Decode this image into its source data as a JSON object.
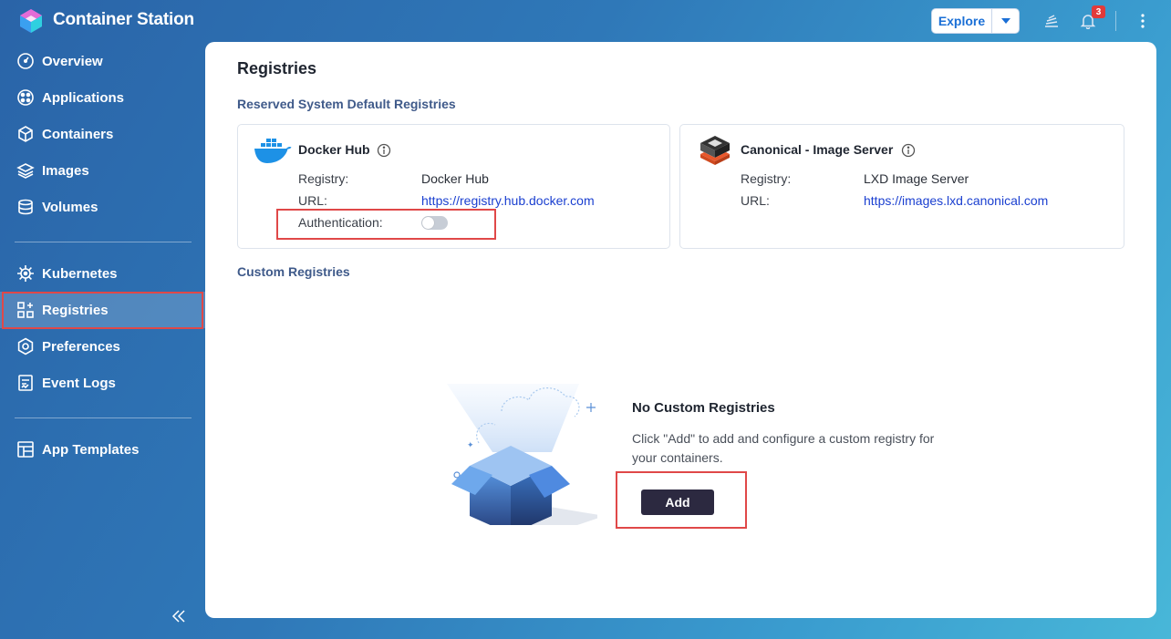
{
  "app": {
    "title": "Container Station",
    "logo_icon": "container-station-logo-icon"
  },
  "header": {
    "explore_label": "Explore",
    "notification_count": "3",
    "icons": [
      "explore-caret-icon",
      "tasks-stack-icon",
      "bell-icon",
      "more-vertical-icon"
    ]
  },
  "sidebar": {
    "items": [
      {
        "label": "Overview",
        "icon": "gauge-icon"
      },
      {
        "label": "Applications",
        "icon": "apps-icon"
      },
      {
        "label": "Containers",
        "icon": "cube-icon"
      },
      {
        "label": "Images",
        "icon": "layers-icon"
      },
      {
        "label": "Volumes",
        "icon": "database-icon"
      },
      {
        "label": "Kubernetes",
        "icon": "helm-icon"
      },
      {
        "label": "Registries",
        "icon": "registry-grid-icon",
        "active": true
      },
      {
        "label": "Preferences",
        "icon": "gear-icon"
      },
      {
        "label": "Event Logs",
        "icon": "log-icon"
      },
      {
        "label": "App Templates",
        "icon": "template-icon"
      }
    ]
  },
  "main": {
    "title": "Registries",
    "default_section_title": "Reserved System Default Registries",
    "custom_section_title": "Custom Registries",
    "registries": [
      {
        "name": "Docker Hub",
        "icon": "docker-whale-icon",
        "registry_label": "Registry:",
        "registry_value": "Docker Hub",
        "url_label": "URL:",
        "url_value": "https://registry.hub.docker.com",
        "auth_label": "Authentication:",
        "auth_enabled": false
      },
      {
        "name": "Canonical - Image Server",
        "icon": "lxd-server-icon",
        "registry_label": "Registry:",
        "registry_value": "LXD Image Server",
        "url_label": "URL:",
        "url_value": "https://images.lxd.canonical.com"
      }
    ],
    "empty_state": {
      "title": "No Custom Registries",
      "description": "Click \"Add\" to add and configure a custom registry for your containers.",
      "add_label": "Add",
      "illustration": "open-box-illustration"
    }
  },
  "colors": {
    "accent": "#1a6fd6",
    "section_title": "#3f5a8a",
    "link": "#1a3fd0",
    "add_button": "#2c2940",
    "highlight": "#e04848"
  }
}
